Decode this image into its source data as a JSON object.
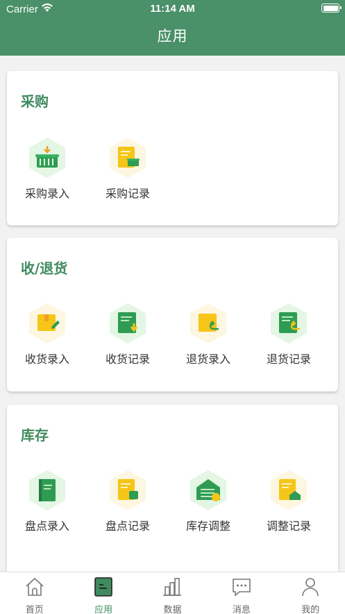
{
  "status_bar": {
    "carrier": "Carrier",
    "time": "11:14 AM"
  },
  "header": {
    "title": "应用"
  },
  "sections": [
    {
      "title": "采购",
      "items": [
        {
          "label": "采购录入",
          "icon": "purchase-entry-icon"
        },
        {
          "label": "采购记录",
          "icon": "purchase-record-icon"
        }
      ]
    },
    {
      "title": "收/退货",
      "items": [
        {
          "label": "收货录入",
          "icon": "receive-entry-icon"
        },
        {
          "label": "收货记录",
          "icon": "receive-record-icon"
        },
        {
          "label": "退货录入",
          "icon": "return-entry-icon"
        },
        {
          "label": "退货记录",
          "icon": "return-record-icon"
        }
      ]
    },
    {
      "title": "库存",
      "items": [
        {
          "label": "盘点录入",
          "icon": "stocktake-entry-icon"
        },
        {
          "label": "盘点记录",
          "icon": "stocktake-record-icon"
        },
        {
          "label": "库存调整",
          "icon": "stock-adjust-icon"
        },
        {
          "label": "调整记录",
          "icon": "adjust-record-icon"
        }
      ]
    }
  ],
  "tabbar": {
    "items": [
      {
        "label": "首页",
        "icon": "home-icon"
      },
      {
        "label": "应用",
        "icon": "apps-icon",
        "active": true
      },
      {
        "label": "数据",
        "icon": "data-icon"
      },
      {
        "label": "消息",
        "icon": "message-icon"
      },
      {
        "label": "我的",
        "icon": "profile-icon"
      }
    ]
  },
  "colors": {
    "primary": "#4a9068",
    "accent_green": "#3f8a5e",
    "yellow": "#f5c518",
    "hex_green_bg": "#e6f6e6",
    "hex_yellow_bg": "#fdf6e0"
  }
}
